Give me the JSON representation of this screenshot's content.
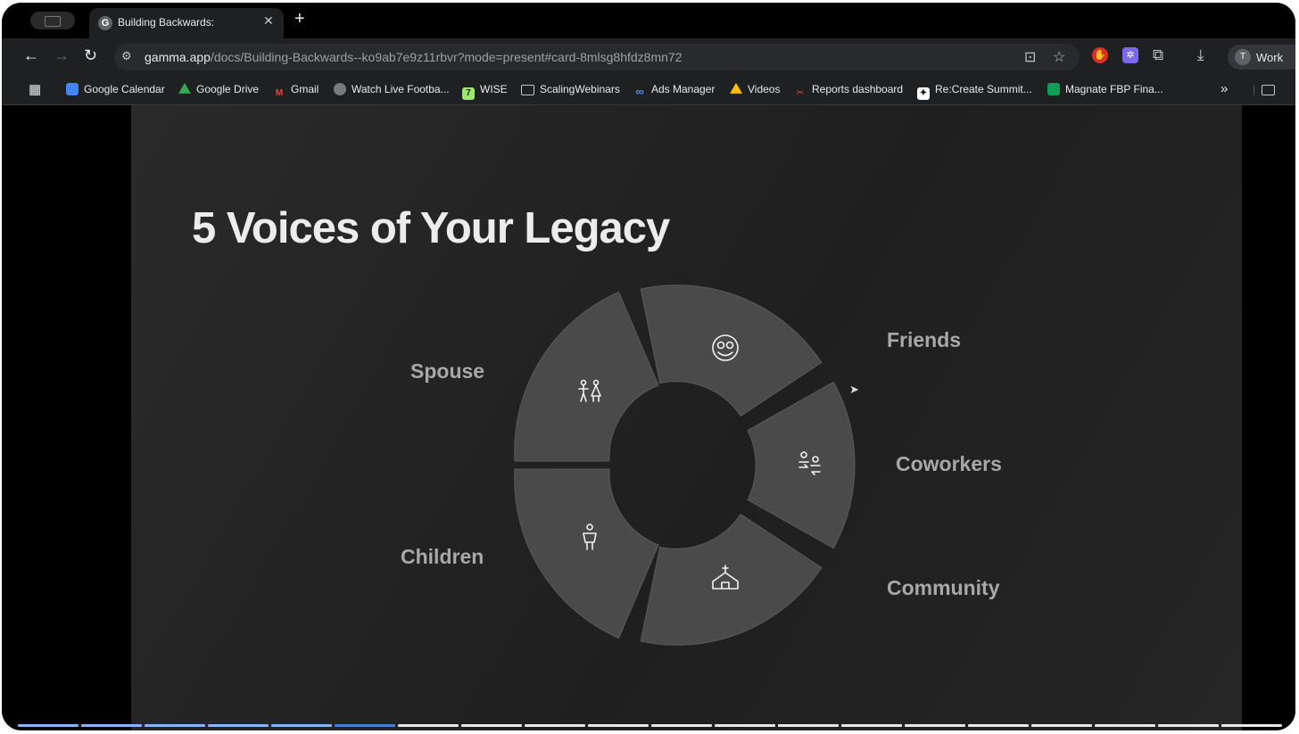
{
  "browser": {
    "tab_title": "Building Backwards:",
    "tab_favicon": "G",
    "close_glyph": "✕",
    "new_tab_glyph": "+",
    "url_host": "gamma.app",
    "url_path": "/docs/Building-Backwards--ko9ab7e9z11rbvr?mode=present#card-8mlsg8hfdz8mn72",
    "profile_initial": "T",
    "profile_label": "Work"
  },
  "bookmarks": [
    {
      "label": "Google Calendar",
      "icon": "calendar-icon",
      "color": "#4285f4"
    },
    {
      "label": "Google Drive",
      "icon": "drive-icon",
      "color": "#34a853"
    },
    {
      "label": "Gmail",
      "icon": "gmail-icon",
      "color": "#ea4335"
    },
    {
      "label": "Watch Live Footba...",
      "icon": "football-icon",
      "color": "#7a7a7a"
    },
    {
      "label": "WISE",
      "icon": "wise-icon",
      "color": "#9fe870"
    },
    {
      "label": "ScalingWebinars",
      "icon": "folder-icon",
      "color": "#1f2022"
    },
    {
      "label": "Ads Manager",
      "icon": "meta-icon",
      "color": "#1f2022"
    },
    {
      "label": "Videos",
      "icon": "drive-icon",
      "color": "#fbbc04"
    },
    {
      "label": "Reports dashboard",
      "icon": "reports-icon",
      "color": "#1f2022"
    },
    {
      "label": "Re:Create Summit...",
      "icon": "recreate-icon",
      "color": "#ffffff"
    },
    {
      "label": "Magnate FBP Fina...",
      "icon": "sheets-icon",
      "color": "#0f9d58"
    }
  ],
  "slide": {
    "title": "5 Voices of Your Legacy",
    "segments": [
      {
        "label": "Spouse",
        "icon": "couple-icon"
      },
      {
        "label": "Friends",
        "icon": "smiling-face-icon"
      },
      {
        "label": "Coworkers",
        "icon": "coworkers-exchange-icon"
      },
      {
        "label": "Community",
        "icon": "church-icon"
      },
      {
        "label": "Children",
        "icon": "child-icon"
      }
    ]
  },
  "presentation": {
    "progress_fraction": 0.3
  }
}
